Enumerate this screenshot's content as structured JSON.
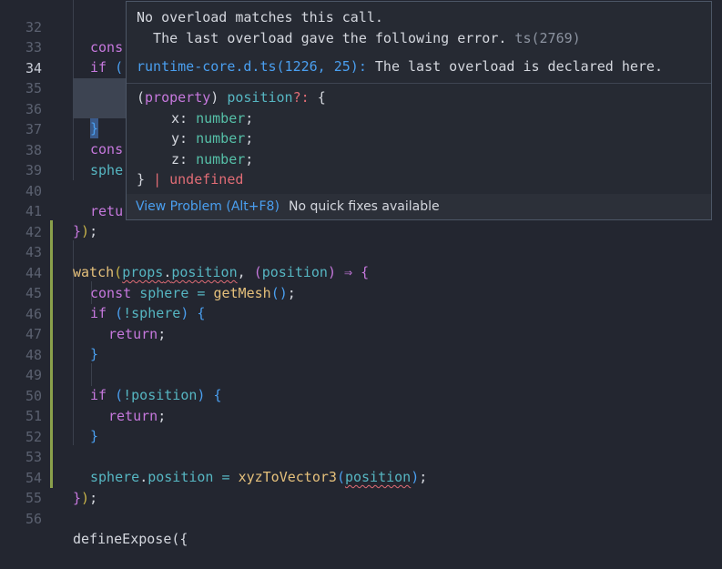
{
  "editor": {
    "active_line": 34,
    "lines": [
      {
        "n": "32",
        "code": "  cons"
      },
      {
        "n": "33",
        "code": "  if ("
      },
      {
        "n": "34",
        "code": "    re"
      },
      {
        "n": "35",
        "code": "  }"
      },
      {
        "n": "36",
        "code": ""
      },
      {
        "n": "37",
        "code": "  cons"
      },
      {
        "n": "38",
        "code": "  sphe"
      },
      {
        "n": "39",
        "code": ""
      },
      {
        "n": "40",
        "code": "  retu"
      },
      {
        "n": "41",
        "code": "});"
      },
      {
        "n": "42",
        "code": ""
      },
      {
        "n": "43",
        "code": "watch(props.position, (position) ⇒ {"
      },
      {
        "n": "44",
        "code": "  const sphere = getMesh();"
      },
      {
        "n": "45",
        "code": "  if (!sphere) {"
      },
      {
        "n": "46",
        "code": "    return;"
      },
      {
        "n": "47",
        "code": "  }"
      },
      {
        "n": "48",
        "code": ""
      },
      {
        "n": "49",
        "code": "  if (!position) {"
      },
      {
        "n": "50",
        "code": "    return;"
      },
      {
        "n": "51",
        "code": "  }"
      },
      {
        "n": "52",
        "code": ""
      },
      {
        "n": "53",
        "code": "  sphere.position = xyzToVector3(position);"
      },
      {
        "n": "54",
        "code": "});"
      },
      {
        "n": "55",
        "code": ""
      },
      {
        "n": "56",
        "code": "defineExpose({"
      }
    ]
  },
  "hover": {
    "message_line1": "No overload matches this call.",
    "message_line2": "  The last overload gave the following error.",
    "error_code": "ts(2769)",
    "related_link": "runtime-core.d.ts(1226, 25):",
    "related_text": "The last overload is declared here.",
    "signature": {
      "open_paren": "(",
      "kind": "property",
      "close_paren": ")",
      "name": "position",
      "optional_mark": "?:",
      "open_brace": "{",
      "fields": [
        {
          "name": "x:",
          "type": "number",
          "semi": ";"
        },
        {
          "name": "y:",
          "type": "number",
          "semi": ";"
        },
        {
          "name": "z:",
          "type": "number",
          "semi": ";"
        }
      ],
      "close_brace": "}",
      "union": "| undefined"
    },
    "footer": {
      "view_problem": "View Problem (Alt+F8)",
      "no_fixes": "No quick fixes available"
    }
  },
  "colors": {
    "background": "#232630",
    "hover_border": "#4c5666",
    "link": "#4a9ff0",
    "git_modified": "#8aa04b",
    "error_squiggle": "#e06c75"
  }
}
